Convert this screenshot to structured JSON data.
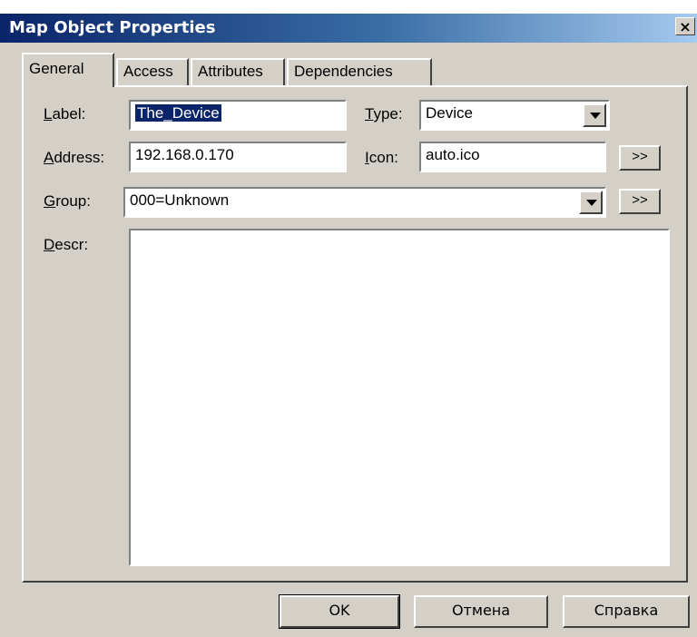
{
  "window": {
    "title": "Map Object Properties",
    "close_glyph": "×"
  },
  "tabs": [
    {
      "label": "General",
      "active": true
    },
    {
      "label": "Access",
      "active": false
    },
    {
      "label": "Attributes",
      "active": false
    },
    {
      "label": "Dependencies",
      "active": false
    }
  ],
  "general": {
    "label_label_mnemonic": "L",
    "label_label_rest": "abel:",
    "label_value": "The_Device",
    "type_label_mnemonic": "T",
    "type_label_rest": "ype:",
    "type_value": "Device",
    "address_label_mnemonic": "A",
    "address_label_rest": "ddress:",
    "address_value": "192.168.0.170",
    "icon_label_mnemonic": "I",
    "icon_label_rest": "con:",
    "icon_value": "auto.ico",
    "icon_browse": ">>",
    "group_label_mnemonic": "G",
    "group_label_rest": "roup:",
    "group_value": "000=Unknown",
    "group_browse": ">>",
    "descr_label_mnemonic": "D",
    "descr_label_rest": "escr:",
    "descr_value": ""
  },
  "buttons": {
    "ok": "OK",
    "cancel": "Отмена",
    "help": "Справка"
  },
  "icons": {
    "close": "close-icon",
    "dropdown": "chevron-down-icon"
  }
}
